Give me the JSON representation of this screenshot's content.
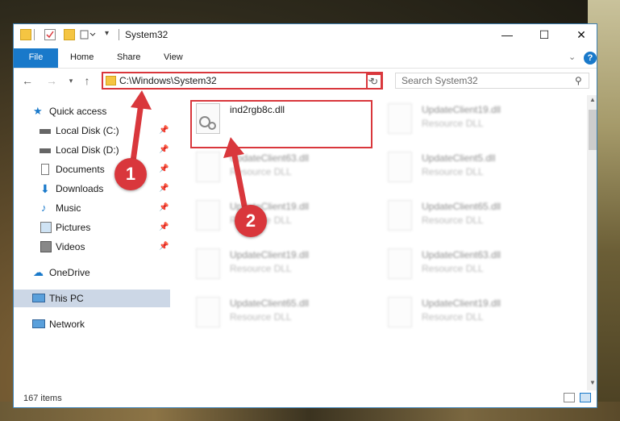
{
  "window": {
    "title": "System32"
  },
  "ribbon": {
    "tabs": [
      "File",
      "Home",
      "Share",
      "View"
    ]
  },
  "address": {
    "path": "C:\\Windows\\System32",
    "search_placeholder": "Search System32"
  },
  "sidebar": {
    "items": [
      {
        "label": "Quick access"
      },
      {
        "label": "Local Disk (C:)"
      },
      {
        "label": "Local Disk (D:)"
      },
      {
        "label": "Documents"
      },
      {
        "label": "Downloads"
      },
      {
        "label": "Music"
      },
      {
        "label": "Pictures"
      },
      {
        "label": "Videos"
      },
      {
        "label": "OneDrive"
      },
      {
        "label": "This PC"
      },
      {
        "label": "Network"
      }
    ]
  },
  "files": [
    {
      "name": "ind2rgb8c.dll",
      "type": ""
    },
    {
      "name": "UpdateClient19.dll",
      "type": "Resource DLL"
    },
    {
      "name": "UpdateClient63.dll",
      "type": "Resource DLL"
    },
    {
      "name": "UpdateClient5.dll",
      "type": "Resource DLL"
    },
    {
      "name": "UpdateClient19.dll",
      "type": "Resource DLL"
    },
    {
      "name": "UpdateClient65.dll",
      "type": "Resource DLL"
    },
    {
      "name": "UpdateClient19.dll",
      "type": "Resource DLL"
    },
    {
      "name": "UpdateClient63.dll",
      "type": "Resource DLL"
    },
    {
      "name": "UpdateClient65.dll",
      "type": "Resource DLL"
    },
    {
      "name": "UpdateClient19.dll",
      "type": "Resource DLL"
    }
  ],
  "status": {
    "count": "167 items"
  },
  "annotations": {
    "marker1": "1",
    "marker2": "2"
  },
  "colors": {
    "accent": "#1979ca",
    "highlight": "#d9373c",
    "selected": "#ccd7e6"
  }
}
